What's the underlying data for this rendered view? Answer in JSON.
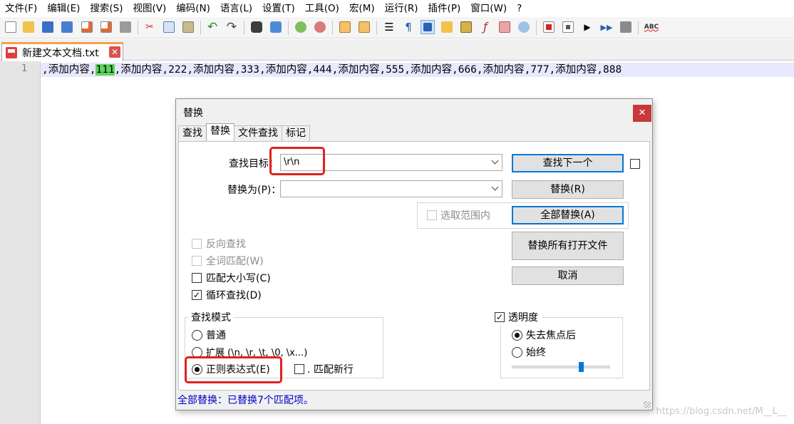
{
  "menu": [
    "文件(F)",
    "编辑(E)",
    "搜索(S)",
    "视图(V)",
    "编码(N)",
    "语言(L)",
    "设置(T)",
    "工具(O)",
    "宏(M)",
    "运行(R)",
    "插件(P)",
    "窗口(W)",
    "?"
  ],
  "toolbar": {
    "icons": [
      "new-file-icon",
      "open-file-icon",
      "save-icon",
      "save-all-icon",
      "close-icon",
      "close-all-icon",
      "print-icon",
      "cut-icon",
      "copy-icon",
      "paste-icon",
      "undo-icon",
      "redo-icon",
      "find-icon",
      "replace-icon",
      "zoom-in-icon",
      "zoom-out-icon",
      "sync-vertical-icon",
      "sync-horizontal-icon",
      "word-wrap-icon",
      "show-all-chars-icon",
      "indent-guide-icon",
      "document-map-icon",
      "function-list-icon",
      "folder-workspace-icon",
      "monitoring-icon",
      "macro-record-icon",
      "macro-stop-icon",
      "macro-play-icon",
      "macro-run-multiple-icon",
      "macro-save-icon",
      "spell-check-icon"
    ],
    "spellcheck_label": "ABC"
  },
  "tab": {
    "title": "新建文本文档.txt",
    "close": "✕"
  },
  "editor": {
    "line_number": "1",
    "text_before": ",添加内容,",
    "text_highlight": "111",
    "text_after": ",添加内容,222,添加内容,333,添加内容,444,添加内容,555,添加内容,666,添加内容,777,添加内容,888"
  },
  "dialog": {
    "title": "替换",
    "close": "✕",
    "tabs": [
      "查找",
      "替换",
      "文件查找",
      "标记"
    ],
    "active_tab": "替换",
    "find_label": "查找目标：",
    "find_value": "\\r\\n",
    "replace_label": "替换为(P)：",
    "replace_value": "",
    "in_selection_label": "选取范围内",
    "buttons": {
      "find_next": "查找下一个",
      "replace": "替换(R)",
      "replace_all": "全部替换(A)",
      "replace_all_open": "替换所有打开文件",
      "cancel": "取消"
    },
    "options": {
      "backward": "反向查找",
      "whole_word": "全词匹配(W)",
      "match_case": "匹配大小写(C)",
      "wrap_around": "循环查找(D)",
      "wrap_around_checked": "✓"
    },
    "search_mode": {
      "title": "查找模式",
      "normal": "普通",
      "extended": "扩展 (\\n, \\r, \\t, \\0, \\x...)",
      "regex": "正则表达式(E)",
      "dot_newline": ". 匹配新行",
      "selected": "regex"
    },
    "transparency": {
      "title": "透明度",
      "title_checked": "✓",
      "on_lose_focus": "失去焦点后",
      "always": "始终",
      "selected": "on_lose_focus",
      "slider_value": 0.72
    },
    "status": "全部替换：已替换7个匹配项。"
  },
  "watermark": "https://blog.csdn.net/M__L__"
}
